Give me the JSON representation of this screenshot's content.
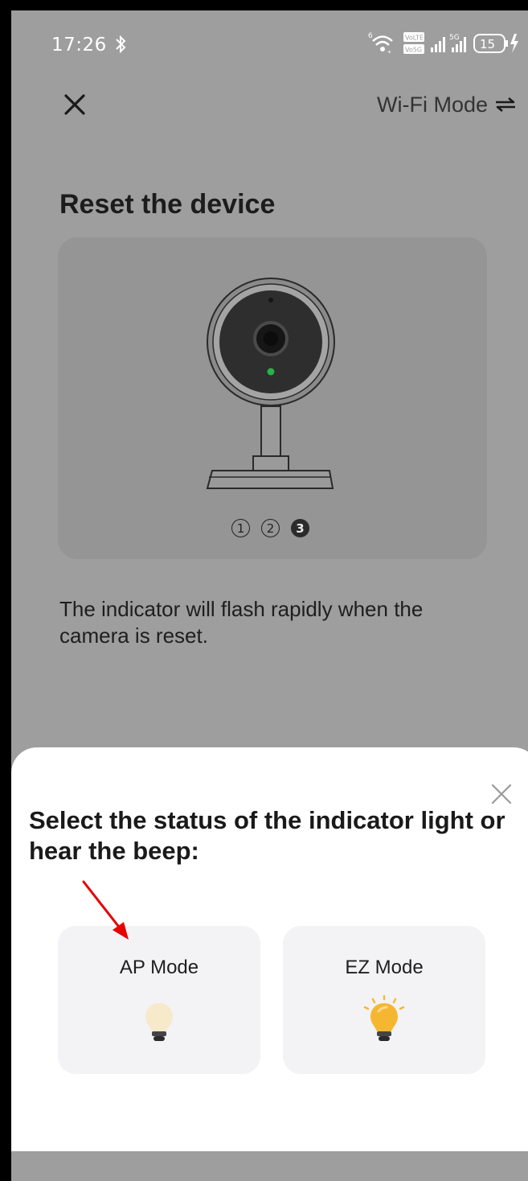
{
  "status_bar": {
    "time": "17:26",
    "battery": "15",
    "lte_label_1": "VoLTE",
    "lte_label_2": "Vo5G",
    "net_label": "5G"
  },
  "header": {
    "mode_label": "Wi-Fi Mode"
  },
  "page": {
    "title": "Reset the device",
    "steps": [
      "1",
      "2",
      "3"
    ],
    "active_step": "3",
    "description": "The indicator will flash rapidly when the camera is reset."
  },
  "sheet": {
    "title": "Select the status of the indicator light or hear the beep:",
    "options": [
      {
        "label": "AP Mode",
        "icon": "bulb-dim-icon"
      },
      {
        "label": "EZ Mode",
        "icon": "bulb-flashing-icon"
      }
    ]
  },
  "colors": {
    "overlay": "#9e9e9e",
    "sheet_bg": "#ffffff",
    "card_bg": "#f3f3f5",
    "arrow": "#e60000",
    "bulb_flash": "#f5b731",
    "led": "#27b24a"
  }
}
